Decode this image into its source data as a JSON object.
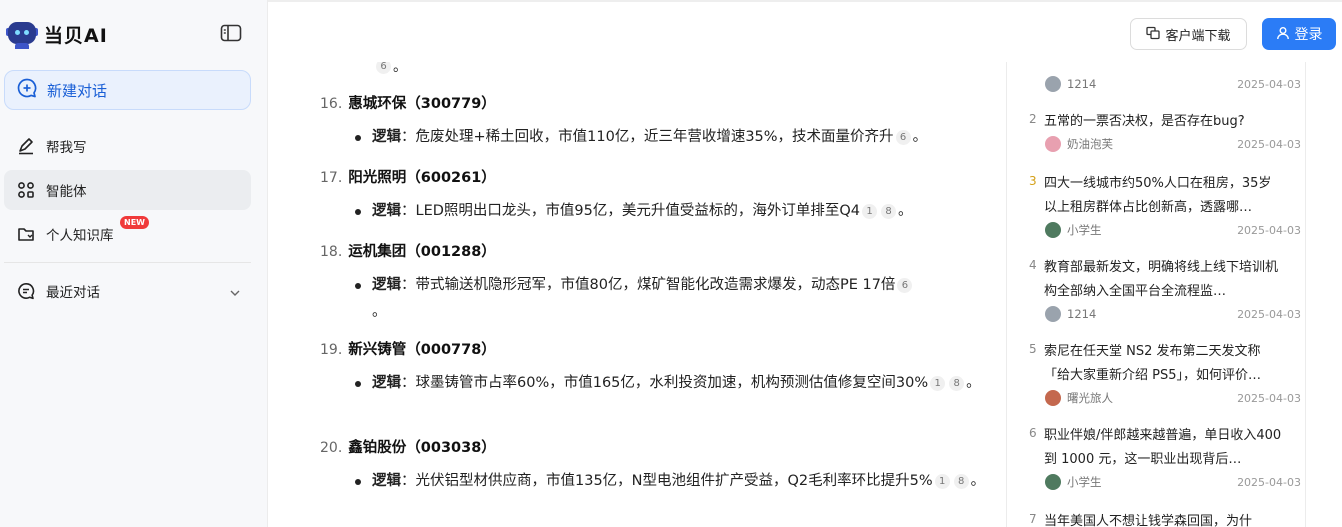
{
  "sidebar": {
    "brand": "当贝AI",
    "new_chat": "新建对话",
    "items": [
      {
        "label": "帮我写"
      },
      {
        "label": "智能体"
      },
      {
        "label": "个人知识库",
        "badge": "NEW"
      },
      {
        "label": "最近对话"
      }
    ]
  },
  "topbar": {
    "download_label": "客户端下载",
    "login_label": "登录"
  },
  "main": {
    "top_citation": "6",
    "top_tail": "。",
    "stocks": [
      {
        "num": "16.",
        "name": "惠城环保（300779）",
        "logic_label": "逻辑",
        "logic_text": "：危废处理+稀土回收，市值110亿，近三年营收增速35%，技术面量价齐升",
        "cites": [
          "6"
        ],
        "tail": "。"
      },
      {
        "num": "17.",
        "name": "阳光照明（600261）",
        "logic_label": "逻辑",
        "logic_text": "：LED照明出口龙头，市值95亿，美元升值受益标的，海外订单排至Q4",
        "cites": [
          "1",
          "8"
        ],
        "tail": "。"
      },
      {
        "num": "18.",
        "name": "运机集团（001288）",
        "logic_label": "逻辑",
        "logic_text": "：带式输送机隐形冠军，市值80亿，煤矿智能化改造需求爆发，动态PE 17倍",
        "cites": [
          "6"
        ],
        "tail": "。"
      },
      {
        "num": "19.",
        "name": "新兴铸管（000778）",
        "logic_label": "逻辑",
        "logic_text": "：球墨铸管市占率60%，市值165亿，水利投资加速，机构预测估值修复空间30%",
        "cites": [
          "1",
          "8"
        ],
        "tail": "。"
      },
      {
        "num": "20.",
        "name": "鑫铂股份（003038）",
        "logic_label": "逻辑",
        "logic_text": "：光伏铝型材供应商，市值135亿，N型电池组件扩产受益，Q2毛利率环比提升5%",
        "cites": [
          "1",
          "8"
        ],
        "tail": "。"
      }
    ]
  },
  "hot_list": [
    {
      "rank": "",
      "title": "",
      "author": "1214",
      "date": "2025-04-03",
      "avatar_color": "#9aa3ad"
    },
    {
      "rank": "2",
      "title": "五常的一票否决权，是否存在bug?",
      "author": "奶油泡芙",
      "date": "2025-04-03",
      "avatar_color": "#e8a0b0"
    },
    {
      "rank": "3",
      "title": "四大一线城市约50%人口在租房，35岁以上租房群体占比创新高，透露哪…",
      "author": "小学生",
      "date": "2025-04-03",
      "avatar_color": "#4f7a5f"
    },
    {
      "rank": "4",
      "title": "教育部最新发文，明确将线上线下培训机构全部纳入全国平台全流程监…",
      "author": "1214",
      "date": "2025-04-03",
      "avatar_color": "#9aa3ad"
    },
    {
      "rank": "5",
      "title": "索尼在任天堂 NS2 发布第二天发文称「给大家重新介绍 PS5」，如何评价…",
      "author": "曙光旅人",
      "date": "2025-04-03",
      "avatar_color": "#c4684e"
    },
    {
      "rank": "6",
      "title": "职业伴娘/伴郎越来越普遍，单日收入400 到 1000 元，这一职业出现背后…",
      "author": "小学生",
      "date": "2025-04-03",
      "avatar_color": "#4f7a5f"
    },
    {
      "rank": "7",
      "title": "当年美国人不想让钱学森回国，为什",
      "author": "",
      "date": "",
      "avatar_color": ""
    }
  ]
}
